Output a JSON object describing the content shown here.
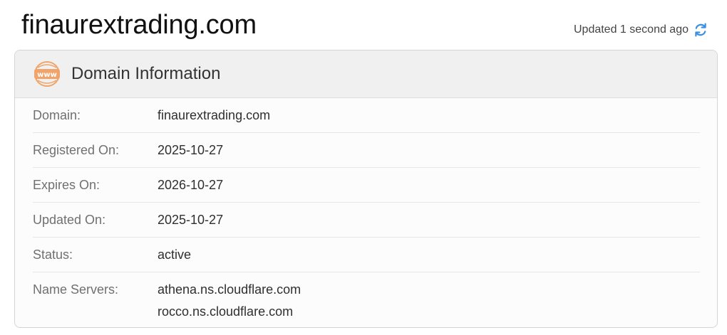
{
  "page": {
    "title": "finaurextrading.com",
    "updated_text": "Updated 1 second ago"
  },
  "card": {
    "title": "Domain Information",
    "icon": "www-icon",
    "rows": [
      {
        "label": "Domain:",
        "value": "finaurextrading.com"
      },
      {
        "label": "Registered On:",
        "value": "2025-10-27"
      },
      {
        "label": "Expires On:",
        "value": "2026-10-27"
      },
      {
        "label": "Updated On:",
        "value": "2025-10-27"
      },
      {
        "label": "Status:",
        "value": "active"
      }
    ],
    "name_servers": {
      "label": "Name Servers:",
      "values": [
        "athena.ns.cloudflare.com",
        "rocco.ns.cloudflare.com"
      ]
    }
  },
  "colors": {
    "accent_icon": "#f0a46a",
    "refresh_icon": "#3b8fe0",
    "header_bg": "#f0f0f0"
  }
}
